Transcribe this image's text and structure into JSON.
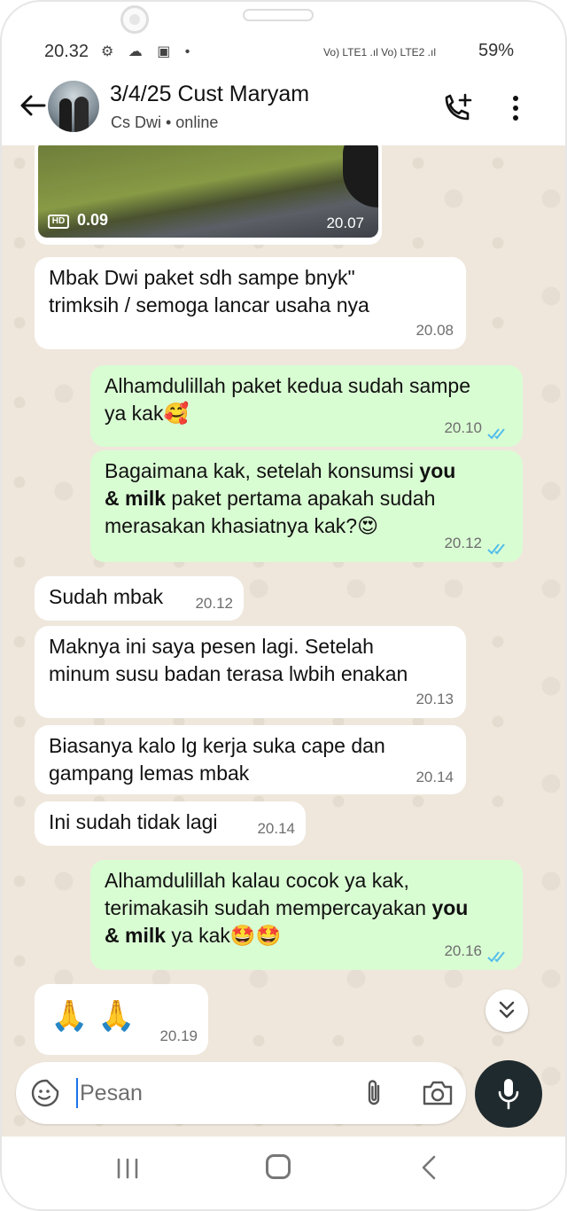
{
  "status_bar": {
    "time": "20.32",
    "left_icons": "⚙ ☁ ▣ •",
    "network": "Vo) LTE1 .ıl  Vo) LTE2 .ıl",
    "battery": "59%"
  },
  "header": {
    "title": "3/4/25 Cust Maryam",
    "subtitle": "Cs Dwi • online"
  },
  "video_message": {
    "badge": "HD",
    "duration": "0.09",
    "time": "20.07"
  },
  "messages": [
    {
      "dir": "in",
      "text_lines": [
        "Mbak Dwi paket sdh sampe bnyk\"",
        "trimksih / semoga lancar usaha nya"
      ],
      "time": "20.08"
    },
    {
      "dir": "out",
      "text_lines": [
        "Alhamdulillah paket kedua sudah sampe",
        "ya kak"
      ],
      "emoji": "🥰",
      "time": "20.10"
    },
    {
      "dir": "out",
      "line1": "Bagaimana kak, setelah konsumsi ",
      "bold1": "you",
      "bold2": "& milk",
      "line2": " paket pertama apakah sudah",
      "line3": "merasakan khasiatnya kak?",
      "emoji": "😍",
      "time": "20.12"
    },
    {
      "dir": "in",
      "text": "Sudah mbak",
      "time": "20.12"
    },
    {
      "dir": "in",
      "text_lines": [
        "Maknya ini saya pesen lagi. Setelah",
        "minum susu badan terasa lwbih enakan"
      ],
      "time": "20.13"
    },
    {
      "dir": "in",
      "text_lines": [
        "Biasanya kalo lg kerja suka cape dan",
        "gampang lemas mbak"
      ],
      "time": "20.14"
    },
    {
      "dir": "in",
      "text": "Ini sudah tidak lagi",
      "time": "20.14"
    },
    {
      "dir": "out",
      "line1": "Alhamdulillah kalau cocok ya kak,",
      "line2": "terimakasih sudah mempercayakan ",
      "bold1": "you",
      "bold2": "& milk",
      "line3": " ya kak",
      "emoji": "🤩🤩",
      "time": "20.16"
    },
    {
      "dir": "in",
      "emoji": "🙏 🙏",
      "time": "20.19"
    }
  ],
  "input": {
    "placeholder": "Pesan"
  },
  "colors": {
    "incoming_bubble": "#ffffff",
    "outgoing_bubble": "#d9fdd3",
    "chat_background": "#efe7dc",
    "read_ticks": "#53bdeb",
    "mic_button": "#1f2a2e"
  }
}
